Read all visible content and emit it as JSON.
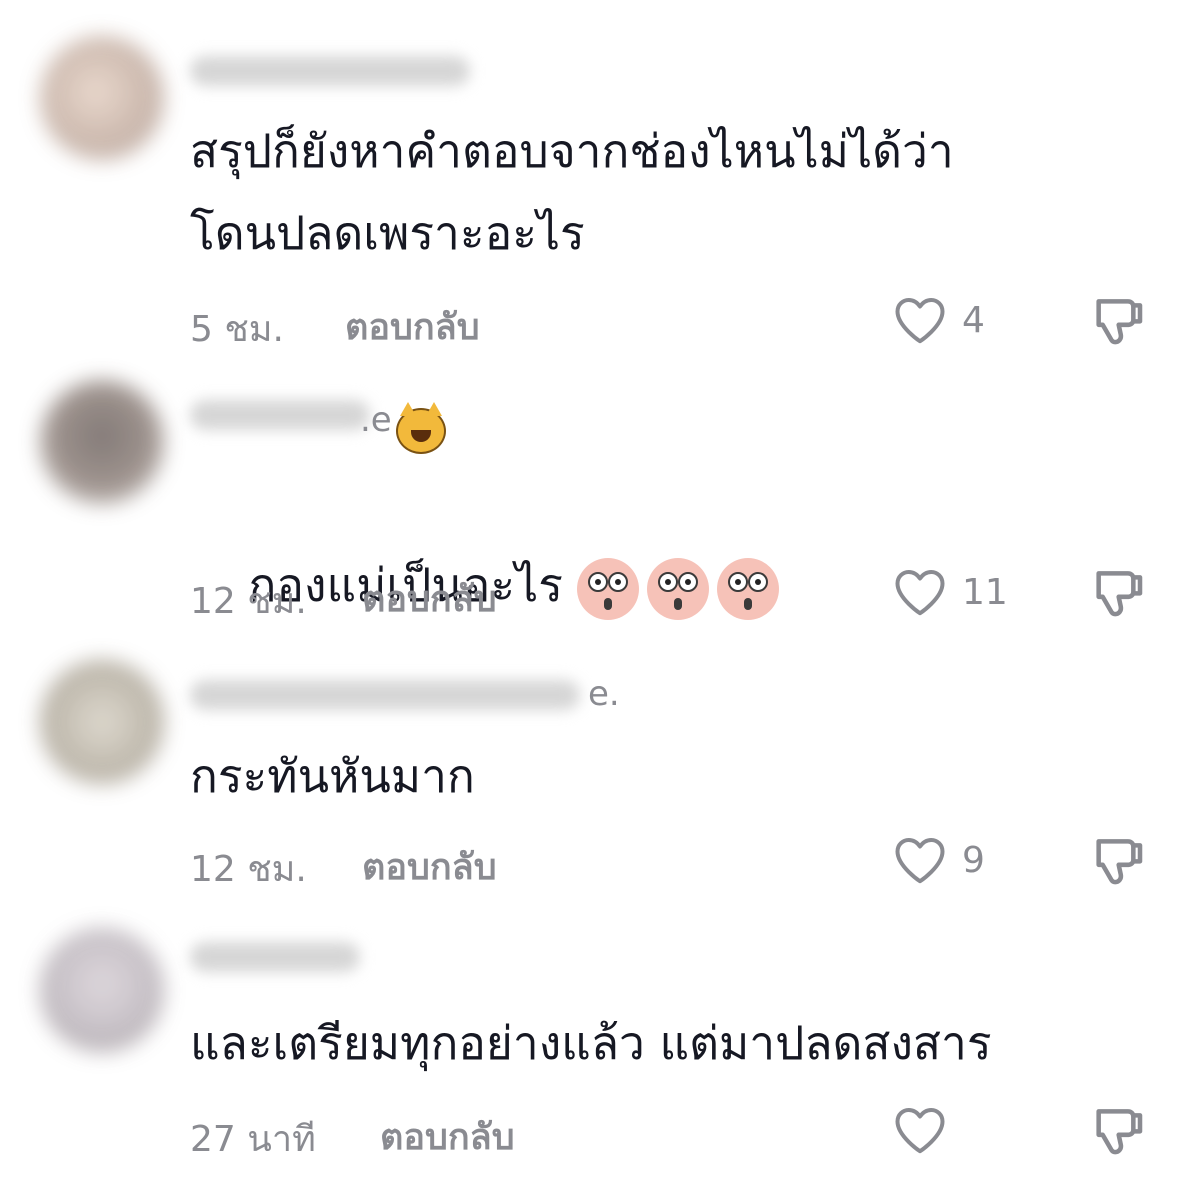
{
  "comments": [
    {
      "text": "สรุปก็ยังหาคำตอบจากช่องไหนไม่ได้ว่า\nโดนปลดเพราะอะไร",
      "time": "5 ชม.",
      "reply_label": "ตอบกลับ",
      "likes": "4",
      "avatar_color": "#c9b3a6"
    },
    {
      "text": "กองแม่เป็นอะไร",
      "time": "12 ชม.",
      "reply_label": "ตอบกลับ",
      "likes": "11",
      "avatar_color": "#8c7f79",
      "username_tail": ".e"
    },
    {
      "text": "กระทันหันมาก",
      "time": "12 ชม.",
      "reply_label": "ตอบกลับ",
      "likes": "9",
      "avatar_color": "#b9b2a4",
      "username_tail": "e."
    },
    {
      "text": "และเตรียมทุกอย่างแล้ว แต่มาปลดสงสาร",
      "time": "27 นาที",
      "reply_label": "ตอบกลับ",
      "likes": "",
      "avatar_color": "#bfb8bf"
    }
  ],
  "colors": {
    "text": "#161823",
    "muted": "#8a8b91",
    "icon": "#8a8b91"
  },
  "icons": {
    "like": "heart-icon",
    "dislike": "thumbs-down-icon"
  }
}
